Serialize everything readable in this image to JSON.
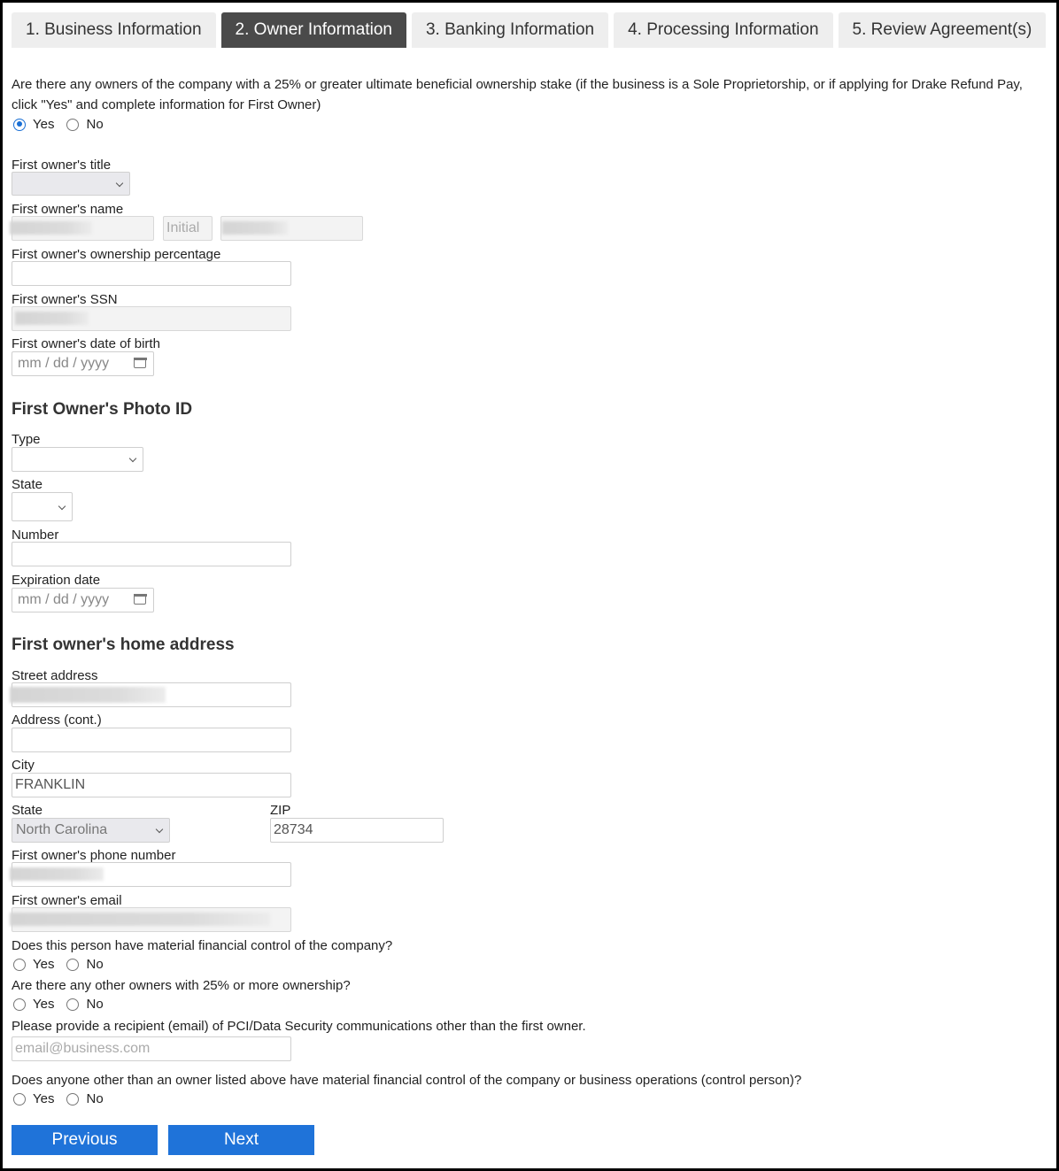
{
  "tabs": [
    {
      "label": "1. Business Information",
      "active": false
    },
    {
      "label": "2. Owner Information",
      "active": true
    },
    {
      "label": "3. Banking Information",
      "active": false
    },
    {
      "label": "4. Processing Information",
      "active": false
    },
    {
      "label": "5. Review Agreement(s)",
      "active": false
    }
  ],
  "ownership_question": {
    "text": "Are there any owners of the company with a 25% or greater ultimate beneficial ownership stake (if the business is a Sole Proprietorship, or if applying for Drake Refund Pay, click \"Yes\" and complete information for First Owner)",
    "yes_label": "Yes",
    "no_label": "No",
    "selected": "Yes"
  },
  "owner": {
    "title_label": "First owner's title",
    "title_value": "",
    "name_label": "First owner's name",
    "first_name_value": "[redacted]",
    "initial_placeholder": "Initial",
    "last_name_value": "[redacted]",
    "percentage_label": "First owner's ownership percentage",
    "percentage_value": "",
    "ssn_label": "First owner's SSN",
    "ssn_value": "[redacted]",
    "dob_label": "First owner's date of birth",
    "dob_placeholder": "mm / dd / yyyy"
  },
  "photo_id": {
    "heading": "First Owner's Photo ID",
    "type_label": "Type",
    "type_value": "",
    "state_label": "State",
    "state_value": "",
    "number_label": "Number",
    "number_value": "",
    "expiration_label": "Expiration date",
    "expiration_placeholder": "mm / dd / yyyy"
  },
  "address": {
    "heading": "First owner's home address",
    "street_label": "Street address",
    "street_value": "[redacted]",
    "cont_label": "Address (cont.)",
    "cont_value": "",
    "city_label": "City",
    "city_value": "FRANKLIN",
    "state_label": "State",
    "state_value": "North Carolina",
    "zip_label": "ZIP",
    "zip_value": "28734",
    "phone_label": "First owner's phone number",
    "phone_value": "[redacted]",
    "email_label": "First owner's email",
    "email_value": "[redacted]"
  },
  "questions": {
    "financial_control": {
      "text": "Does this person have material financial control of the company?",
      "yes_label": "Yes",
      "no_label": "No",
      "selected": null
    },
    "other_owners": {
      "text": "Are there any other owners with 25% or more ownership?",
      "yes_label": "Yes",
      "no_label": "No",
      "selected": null
    },
    "pci_recipient": {
      "text": "Please provide a recipient (email) of PCI/Data Security communications other than the first owner.",
      "placeholder": "email@business.com"
    },
    "control_person": {
      "text": "Does anyone other than an owner listed above have material financial control of the company or business operations (control person)?",
      "yes_label": "Yes",
      "no_label": "No",
      "selected": null
    }
  },
  "buttons": {
    "previous": "Previous",
    "next": "Next"
  },
  "colors": {
    "accent": "#1f73d9",
    "active_tab": "#4a4a4a",
    "inactive_tab": "#eeeeee"
  }
}
